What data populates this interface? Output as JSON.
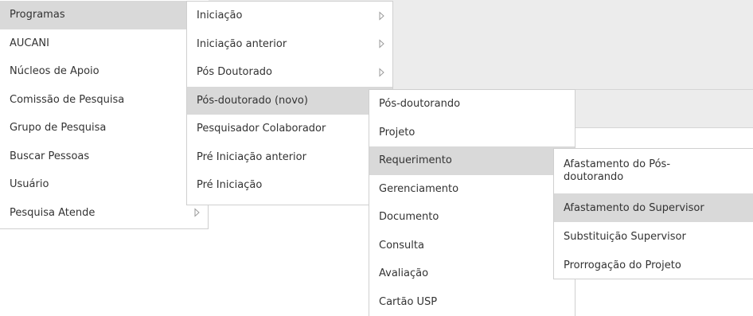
{
  "main_menu": {
    "items": [
      {
        "label": "Programas",
        "active": true,
        "has_submenu": false
      },
      {
        "label": "AUCANI",
        "active": false,
        "has_submenu": false
      },
      {
        "label": "Núcleos de Apoio",
        "active": false,
        "has_submenu": false
      },
      {
        "label": "Comissão de Pesquisa",
        "active": false,
        "has_submenu": false
      },
      {
        "label": "Grupo de Pesquisa",
        "active": false,
        "has_submenu": false
      },
      {
        "label": "Buscar Pessoas",
        "active": false,
        "has_submenu": false
      },
      {
        "label": "Usuário",
        "active": false,
        "has_submenu": false
      },
      {
        "label": "Pesquisa Atende",
        "active": false,
        "has_submenu": true
      }
    ]
  },
  "programas_menu": {
    "items": [
      {
        "label": "Iniciação",
        "active": false,
        "has_submenu": true
      },
      {
        "label": "Iniciação anterior",
        "active": false,
        "has_submenu": true
      },
      {
        "label": "Pós Doutorado",
        "active": false,
        "has_submenu": true
      },
      {
        "label": "Pós-doutorado (novo)",
        "active": true,
        "has_submenu": false
      },
      {
        "label": "Pesquisador Colaborador",
        "active": false,
        "has_submenu": false
      },
      {
        "label": "Pré Iniciação anterior",
        "active": false,
        "has_submenu": false
      },
      {
        "label": "Pré Iniciação",
        "active": false,
        "has_submenu": false
      }
    ]
  },
  "posdoc_menu": {
    "items": [
      {
        "label": "Pós-doutorando",
        "active": false
      },
      {
        "label": "Projeto",
        "active": false
      },
      {
        "label": "Requerimento",
        "active": true
      },
      {
        "label": "Gerenciamento",
        "active": false
      },
      {
        "label": "Documento",
        "active": false
      },
      {
        "label": "Consulta",
        "active": false
      },
      {
        "label": "Avaliação",
        "active": false
      },
      {
        "label": "Cartão USP",
        "active": false
      }
    ]
  },
  "requerimento_menu": {
    "items": [
      {
        "label": "Afastamento do Pós-doutorando",
        "active": false
      },
      {
        "label": "Afastamento do Supervisor",
        "active": true
      },
      {
        "label": "Substituição Supervisor",
        "active": false
      },
      {
        "label": "Prorrogação do Projeto",
        "active": false
      }
    ]
  },
  "colors": {
    "active_bg": "#d9d9d9",
    "border": "#cfcfcf",
    "text": "#333333",
    "page_strip": "#ececec"
  },
  "icons": {
    "submenu_arrow": "submenu-arrow-icon"
  }
}
